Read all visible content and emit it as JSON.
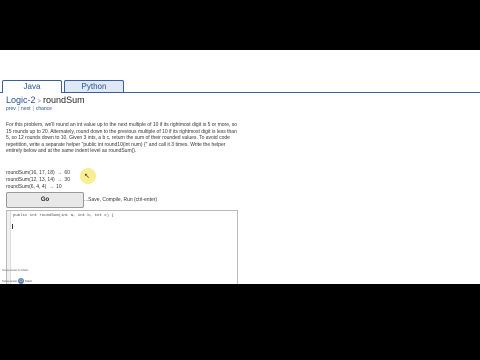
{
  "tabs": [
    {
      "label": "Java",
      "active": true
    },
    {
      "label": "Python",
      "active": false
    }
  ],
  "breadcrumb": {
    "section": "Logic-2",
    "separator": ">",
    "title": "roundSum"
  },
  "nav_links": [
    "prev",
    "next",
    "chance"
  ],
  "nav_separator": "|",
  "description": "For this problem, we'll round an int value up to the next multiple of 10 if its rightmost digit is 5 or more, so 15 rounds up to 20. Alternately, round down to the previous multiple of 10 if its rightmost digit is less than 5, so 12 rounds down to 10. Given 3 ints, a b c, return the sum of their rounded values. To avoid code repetition, write a separate helper \"public int round10(int num) {\" and call it 3 times. Write the helper entirely below and at the same indent level as roundSum().",
  "examples": [
    {
      "call": "roundSum(16, 17, 18)",
      "arrow": "→",
      "result": "60"
    },
    {
      "call": "roundSum(12, 13, 14)",
      "arrow": "→",
      "result": "30"
    },
    {
      "call": "roundSum(6, 4, 4)",
      "arrow": "→",
      "result": "10"
    }
  ],
  "go_button": "Go",
  "go_hint": "...Save, Compile, Run (ctrl-enter)",
  "code_editor": {
    "first_line": "public int roundSum(int a, int b, int c) {"
  },
  "recorder_badge": {
    "line1": "Screencast-O-Matic",
    "brand": "Screencast",
    "mark": "O",
    "brand2": "Matic"
  }
}
